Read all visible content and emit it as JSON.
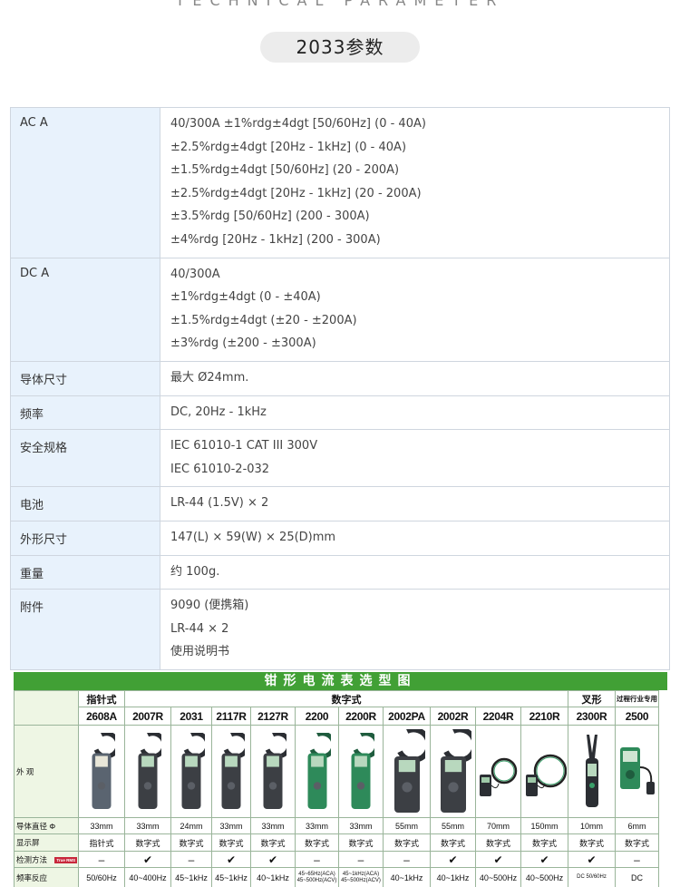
{
  "header": {
    "overline": "TECHNICAL PARAMETER",
    "title": "2033参数"
  },
  "specs": [
    {
      "label": "AC A",
      "lines": [
        "40/300A ±1%rdg±4dgt [50/60Hz] (0 - 40A)",
        "±2.5%rdg±4dgt [20Hz - 1kHz] (0 - 40A)",
        "±1.5%rdg±4dgt [50/60Hz] (20 - 200A)",
        "±2.5%rdg±4dgt [20Hz - 1kHz] (20 - 200A)",
        "±3.5%rdg [50/60Hz] (200 - 300A)",
        "±4%rdg [20Hz - 1kHz] (200 - 300A)"
      ]
    },
    {
      "label": "DC A",
      "lines": [
        "40/300A",
        "±1%rdg±4dgt (0 - ±40A)",
        "±1.5%rdg±4dgt (±20 - ±200A)",
        "±3%rdg (±200 - ±300A)"
      ]
    },
    {
      "label": "导体尺寸",
      "lines": [
        "最大 Ø24mm."
      ]
    },
    {
      "label": "频率",
      "lines": [
        "DC, 20Hz - 1kHz"
      ]
    },
    {
      "label": "安全规格",
      "lines": [
        "IEC 61010-1 CAT III 300V",
        "IEC 61010-2-032"
      ]
    },
    {
      "label": "电池",
      "lines": [
        "LR-44 (1.5V) × 2"
      ]
    },
    {
      "label": "外形尺寸",
      "lines": [
        "147(L) × 59(W) × 25(D)mm"
      ]
    },
    {
      "label": "重量",
      "lines": [
        "约 100g."
      ]
    },
    {
      "label": "附件",
      "lines": [
        "9090 (便携箱)",
        "LR-44 × 2",
        "使用说明书"
      ]
    }
  ],
  "selector": {
    "title": "钳形电流表选型图",
    "groups": {
      "analog": "指针式",
      "digital": "数字式",
      "fork": "叉形",
      "process": "过程行业专用"
    },
    "models": [
      "2608A",
      "2007R",
      "2031",
      "2117R",
      "2127R",
      "2200",
      "2200R",
      "2002PA",
      "2002R",
      "2204R",
      "2210R",
      "2300R",
      "2500"
    ],
    "row_labels": {
      "appearance": "外 观",
      "diameter": "导体直径 Φ",
      "display": "显示屏",
      "method": "检测方法",
      "method_badge": "True RMS",
      "freq": "频率反应"
    },
    "diameter": [
      "33mm",
      "33mm",
      "24mm",
      "33mm",
      "33mm",
      "33mm",
      "33mm",
      "55mm",
      "55mm",
      "70mm",
      "150mm",
      "10mm",
      "6mm"
    ],
    "display": [
      "指针式",
      "数字式",
      "数字式",
      "数字式",
      "数字式",
      "数字式",
      "数字式",
      "数字式",
      "数字式",
      "数字式",
      "数字式",
      "数字式",
      "数字式"
    ],
    "method": [
      "–",
      "✔",
      "–",
      "✔",
      "✔",
      "–",
      "–",
      "–",
      "✔",
      "✔",
      "✔",
      "✔",
      "–"
    ],
    "freq": [
      "50/60Hz",
      "40~400Hz",
      "45~1kHz",
      "45~1kHz",
      "40~1kHz",
      "45~65Hz(ACA) 45~500Hz(ACV)",
      "45~1kHz(ACA) 45~500Hz(ACV)",
      "40~1kHz",
      "40~1kHz",
      "40~500Hz",
      "40~500Hz",
      "DC 50/60Hz",
      "DC"
    ],
    "colors": {
      "header_green": "#41a035",
      "label_bg": "#eef6e4",
      "spec_label_bg": "#e8f2fc"
    }
  }
}
